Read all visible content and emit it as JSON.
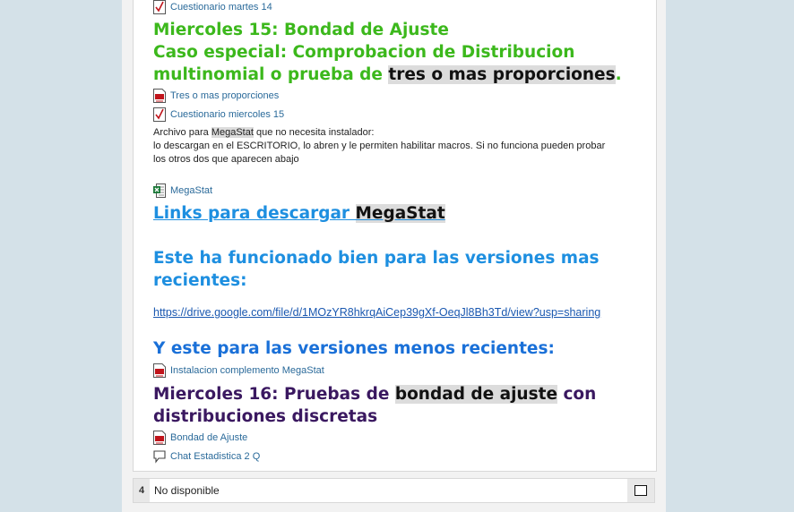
{
  "activities": {
    "quiz_martes": "Cuestionario martes 14",
    "tres_mas": "Tres o mas proporciones",
    "quiz_miercoles": "Cuestionario miercoles 15",
    "megastat_file": "MegaStat",
    "instalacion": "Instalacion complemento MegaStat",
    "bondad": "Bondad de Ajuste",
    "chat": "Chat Estadistica 2 Q"
  },
  "section15": {
    "title": "Miercoles 15: Bondad de Ajuste",
    "line2": "Caso especial: Comprobacion de Distribucion",
    "line3_pre": "multinomial o prueba de ",
    "line3_hl": "tres o mas proporciones",
    "line3_post": "."
  },
  "note": {
    "l1_pre": "Archivo para ",
    "l1_hl": "MegaStat",
    "l1_post": " que no necesita instalador:",
    "l2": "lo descargan en el ESCRITORIO, lo abren y le permiten habilitar macros. Si no funciona pueden probar",
    "l3": "los otros dos que aparecen abajo"
  },
  "links": {
    "heading_pre": "Links para descargar ",
    "heading_hl": "MegaStat",
    "recent_l1": "Este ha funcionado bien para las versiones mas",
    "recent_l2": "recientes:",
    "url": "https://drive.google.com/file/d/1MOzYR8hkrqAiCep39gXf-OeqJl8Bh3Td/view?usp=sharing",
    "older": "Y este para las versiones menos recientes:"
  },
  "section16": {
    "pre": "Miercoles 16: Pruebas de ",
    "hl": "bondad de ajuste",
    "post": " con",
    "line2": "distribuciones discretas"
  },
  "row4": {
    "number": "4",
    "status": "No disponible"
  },
  "colors": {
    "green": "#3cb81c",
    "blue": "#1e8fe0",
    "purple": "#3a1860",
    "link": "#2a6a9a"
  },
  "icons": [
    "quiz-icon",
    "pdf-icon",
    "excel-icon",
    "chat-icon",
    "checkbox-icon"
  ]
}
